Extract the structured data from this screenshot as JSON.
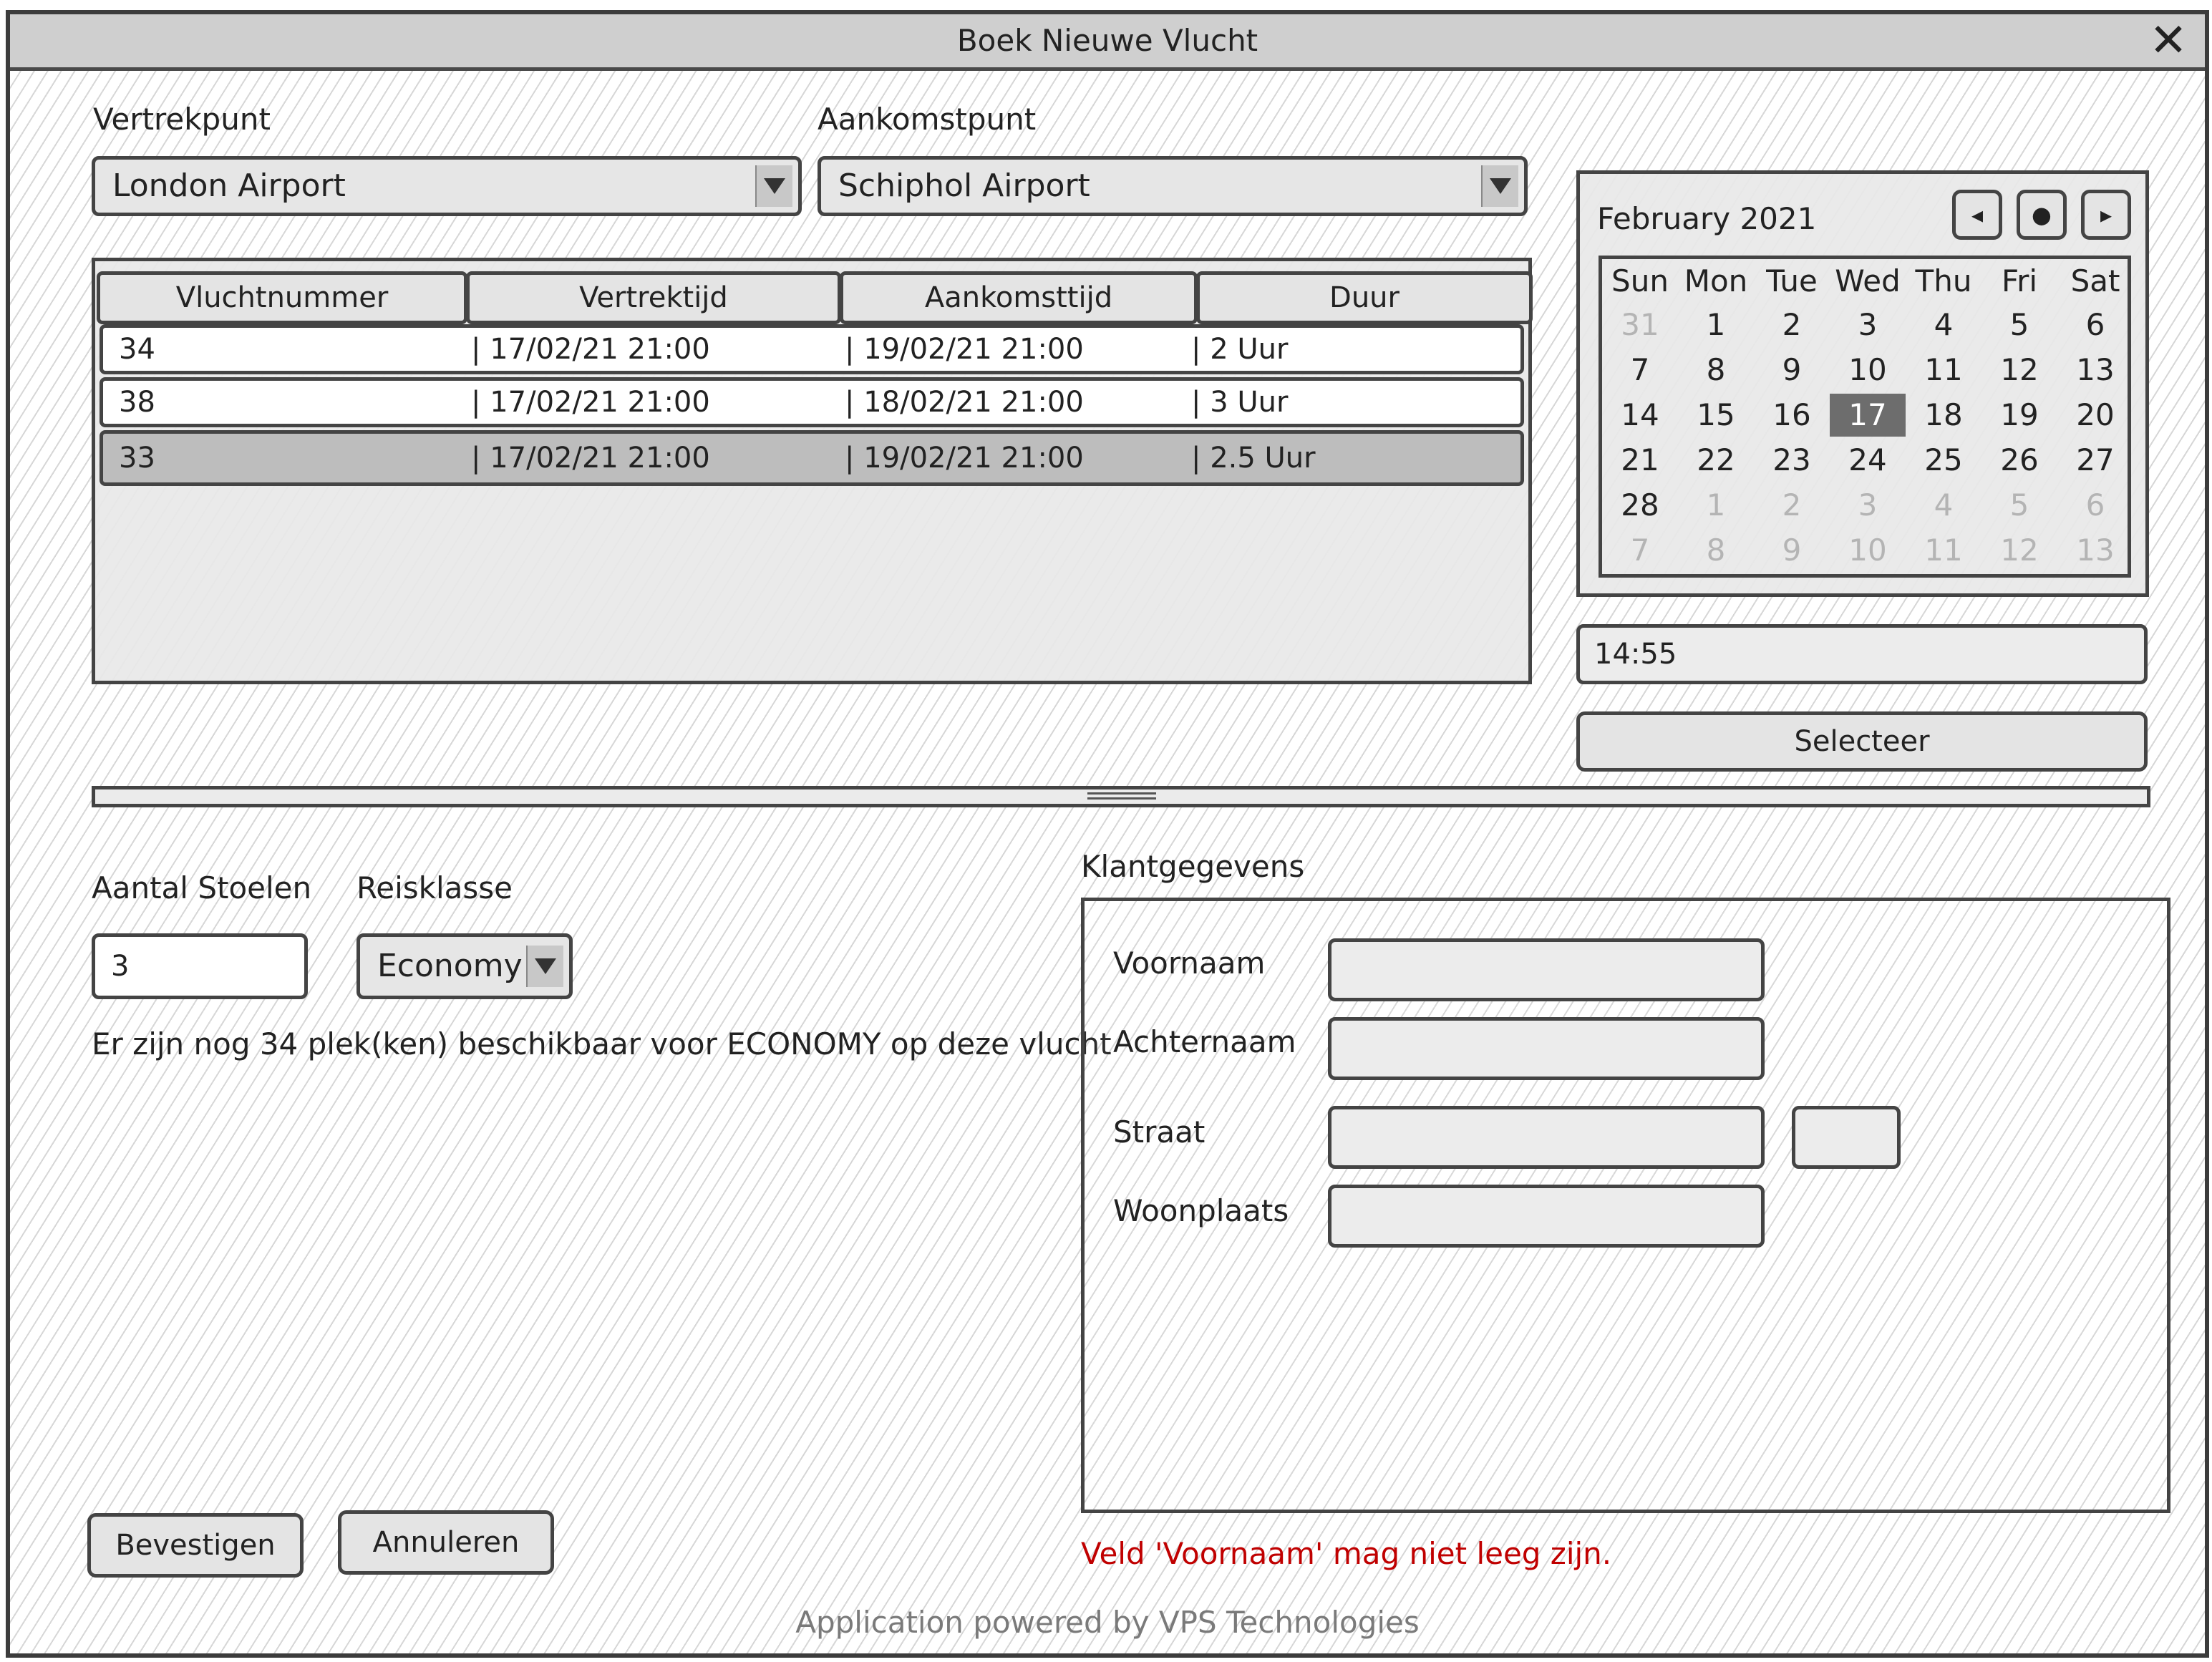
{
  "window": {
    "title": "Boek Nieuwe Vlucht",
    "close_icon": "close-icon"
  },
  "flight_search": {
    "departure_label": "Vertrekpunt",
    "departure_value": "London Airport",
    "arrival_label": "Aankomstpunt",
    "arrival_value": "Schiphol Airport"
  },
  "table": {
    "columns": [
      "Vluchtnummer",
      "Vertrektijd",
      "Aankomsttijd",
      "Duur"
    ],
    "rows": [
      {
        "cells": [
          "34",
          "| 17/02/21 21:00",
          "| 19/02/21 21:00",
          "| 2 Uur"
        ],
        "selected": false
      },
      {
        "cells": [
          "38",
          "| 17/02/21 21:00",
          "| 18/02/21 21:00",
          "| 3 Uur"
        ],
        "selected": false
      },
      {
        "cells": [
          "33",
          "| 17/02/21 21:00",
          "| 19/02/21 21:00",
          "| 2.5 Uur"
        ],
        "selected": true
      }
    ]
  },
  "calendar": {
    "month_label": "February 2021",
    "prev_glyph": "◂",
    "today_glyph": "●",
    "next_glyph": "▸",
    "weekdays": [
      "Sun",
      "Mon",
      "Tue",
      "Wed",
      "Thu",
      "Fri",
      "Sat"
    ],
    "weeks": [
      [
        "31",
        "1",
        "2",
        "3",
        "4",
        "5",
        "6"
      ],
      [
        "7",
        "8",
        "9",
        "10",
        "11",
        "12",
        "13"
      ],
      [
        "14",
        "15",
        "16",
        "17",
        "18",
        "19",
        "20"
      ],
      [
        "21",
        "22",
        "23",
        "24",
        "25",
        "26",
        "27"
      ],
      [
        "28",
        "1",
        "2",
        "3",
        "4",
        "5",
        "6"
      ],
      [
        "7",
        "8",
        "9",
        "10",
        "11",
        "12",
        "13"
      ]
    ],
    "selected_day": "17"
  },
  "time": {
    "value": "14:55"
  },
  "select_button": {
    "label": "Selecteer"
  },
  "booking": {
    "seats_label": "Aantal Stoelen",
    "seats_value": "3",
    "class_label": "Reisklasse",
    "class_value": "Economy",
    "availability_text": "Er zijn nog 34 plek(ken) beschikbaar voor ECONOMY op deze vlucht"
  },
  "customer": {
    "section_label": "Klantgegevens",
    "firstname_label": "Voornaam",
    "firstname_value": "",
    "lastname_label": "Achternaam",
    "lastname_value": "",
    "street_label": "Straat",
    "street_value": "",
    "housenumber_value": "",
    "city_label": "Woonplaats",
    "city_value": ""
  },
  "actions": {
    "confirm_label": "Bevestigen",
    "cancel_label": "Annuleren"
  },
  "validation": {
    "error_text": "Veld 'Voornaam' mag niet leeg zijn.",
    "error_color": "#c00000"
  },
  "footer": {
    "powered_by": "Application powered by VPS Technologies"
  }
}
